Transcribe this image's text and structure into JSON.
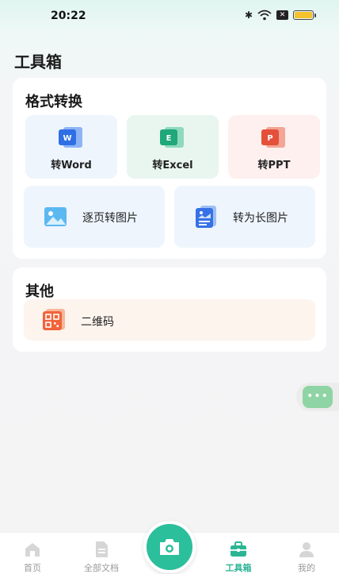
{
  "status_bar": {
    "time": "20:22"
  },
  "page_title": "工具箱",
  "format_section": {
    "title": "格式转换",
    "word_label": "转Word",
    "word_badge": "W",
    "excel_label": "转Excel",
    "excel_badge": "E",
    "ppt_label": "转PPT",
    "ppt_badge": "P",
    "pages_to_images_label": "逐页转图片",
    "to_long_image_label": "转为长图片"
  },
  "other_section": {
    "title": "其他",
    "qr_label": "二维码"
  },
  "float_button": {
    "glyph": "•••"
  },
  "tabbar": {
    "home": "首页",
    "docs": "全部文档",
    "tools": "工具箱",
    "mine": "我的"
  },
  "colors": {
    "accent": "#2bbf9c",
    "word": "#2f6fe4",
    "excel": "#20a77a",
    "ppt": "#e4503a",
    "qr": "#f0643a"
  }
}
